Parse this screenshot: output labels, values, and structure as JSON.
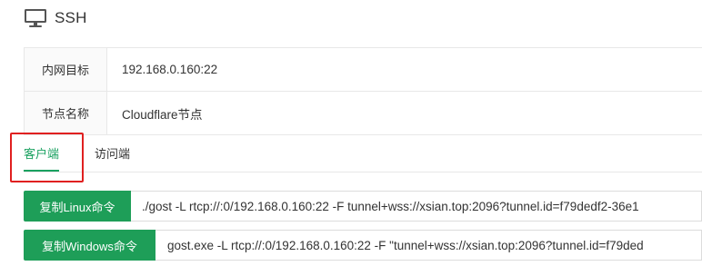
{
  "header": {
    "title": "SSH",
    "icon": "monitor-icon"
  },
  "info": {
    "rows": [
      {
        "label": "内网目标",
        "value": "192.168.0.160:22"
      },
      {
        "label": "节点名称",
        "value": "Cloudflare节点"
      }
    ]
  },
  "tabs": {
    "active": "客户端",
    "items": [
      {
        "label": "客户端"
      },
      {
        "label": "访问端"
      }
    ]
  },
  "commands": [
    {
      "button_label": "复制Linux命令",
      "command": "./gost -L rtcp://:0/192.168.0.160:22 -F tunnel+wss://xsian.top:2096?tunnel.id=f79dedf2-36e1"
    },
    {
      "button_label": "复制Windows命令",
      "command": "gost.exe -L rtcp://:0/192.168.0.160:22 -F \"tunnel+wss://xsian.top:2096?tunnel.id=f79ded"
    }
  ],
  "colors": {
    "accent": "#1aa160",
    "button": "#1e9e58",
    "highlight": "#e02020"
  }
}
